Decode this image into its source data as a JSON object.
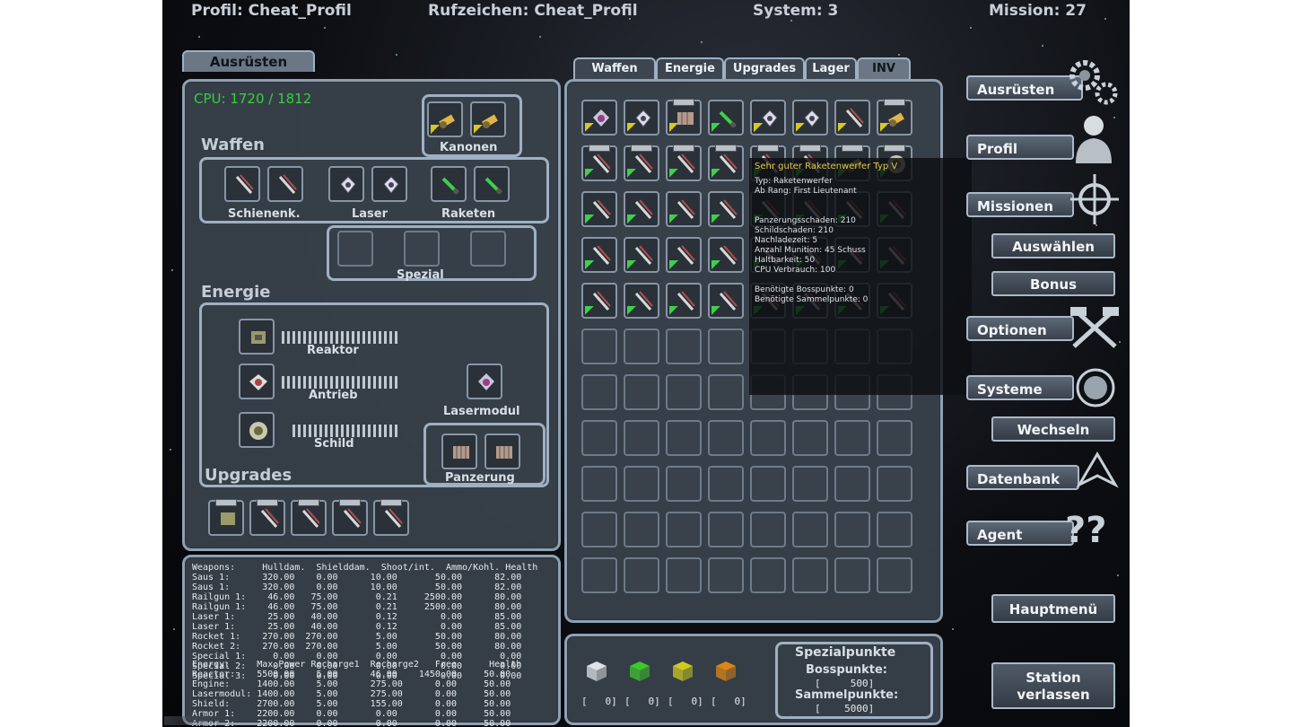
{
  "topbar": {
    "profile": "Profil:  Cheat_Profil",
    "callsign": "Rufzeichen:  Cheat_Profil",
    "system": "System: 3",
    "mission": "Mission: 27"
  },
  "equip_panel": {
    "tab": "Ausrüsten",
    "cpu": "CPU: 1720 / 1812",
    "sections": {
      "weapons": "Waffen",
      "energy": "Energie",
      "upgrades": "Upgrades"
    },
    "labels": {
      "cannons": "Kanonen",
      "railguns": "Schienenk.",
      "laser": "Laser",
      "rockets": "Raketen",
      "special": "Spezial",
      "reactor": "Reaktor",
      "engine": "Antrieb",
      "shield": "Schild",
      "laser_module": "Lasermodul",
      "armor": "Panzerung"
    }
  },
  "inventory": {
    "tabs": [
      "Waffen",
      "Energie",
      "Upgrades",
      "Lager",
      "INV"
    ],
    "active_tab": "INV"
  },
  "tooltip": {
    "title": "Sehr guter Raketenwerfer Typ V",
    "lines": [
      "Typ: Raketenwerfer",
      "Ab Rang: First Lieutenant",
      "",
      "",
      "Panzerungsschaden: 210",
      "Schildschaden: 210",
      "Nachladezeit: 5",
      "Anzahl Munition: 45 Schuss",
      "Haltbarkeit: 50",
      "CPU Verbrauch: 100",
      "",
      "Benötigte Bosspunkte: 0",
      "Benötigte Sammelpunkte: 0"
    ]
  },
  "stats_table": {
    "weapons_header": "Weapons:     Hulldam.  Shielddam.  Shoot/int.  Ammo/Kohl. Health",
    "weapons_rows": [
      "Saus 1:      320.00    0.00      10.00       50.00      82.00",
      "Saus 1:      320.00    0.00      10.00       50.00      82.00",
      "Railgun 1:    46.00   75.00       0.21     2500.00      80.00",
      "Railgun 1:    46.00   75.00       0.21     2500.00      80.00",
      "Laser 1:      25.00   40.00       0.12        0.00      85.00",
      "Laser 1:      25.00   40.00       0.12        0.00      85.00",
      "Rocket 1:    270.00  270.00       5.00       50.00      80.00",
      "Rocket 2:    270.00  270.00       5.00       50.00      80.00",
      "Special 1:     0.00    0.00       0.00        0.00       0.00",
      "Special 2:     0.00    0.00       0.00        0.00       0.00",
      "Special 3:     0.00    0.00       0.00        0.00       0.00"
    ],
    "energy_header": "Energy:     Max.Power Recharge1  Recharge2   Free      Health",
    "energy_rows": [
      "Reactor:    5500.00    5.00      46.00    1450.00     50.00",
      "Engine:     1400.00    5.00      275.00      0.00     50.00",
      "Lasermodul: 1400.00    5.00      275.00      0.00     50.00",
      "Shield:     2700.00    5.00      155.00      0.00     50.00",
      "Armor 1:    2200.00    0.00       0.00       0.00     50.00",
      "Armor 2:    2200.00    0.00       0.00       0.00     50.00"
    ]
  },
  "points": {
    "cubes": [
      {
        "color": "#e8ecef",
        "value": "[   0]"
      },
      {
        "color": "#3fcf2a",
        "value": "[   0]"
      },
      {
        "color": "#d8d21e",
        "value": "[   0]"
      },
      {
        "color": "#e88a12",
        "value": "[   0]"
      }
    ],
    "special_title": "Spezialpunkte",
    "boss_label": "Bosspunkte:",
    "boss_value": "[     500]",
    "collect_label": "Sammelpunkte:",
    "collect_value": "[    5000]"
  },
  "menu": {
    "equip": "Ausrüsten",
    "profile": "Profil",
    "missions": "Missionen",
    "select": "Auswählen",
    "bonus": "Bonus",
    "options": "Optionen",
    "systems": "Systeme",
    "switch": "Wechseln",
    "database": "Datenbank",
    "agent": "Agent",
    "main_menu": "Hauptmenü",
    "leave_station": "Station verlassen"
  },
  "icons": {
    "gear": "gear-icon",
    "pilot": "pilot-portrait-icon",
    "crosshair": "crosshair-icon",
    "hammers": "tools-icon",
    "planet": "planet-icon",
    "ship": "ship-icon",
    "question": "question-icon"
  },
  "colors": {
    "cpu_green": "#36d03a",
    "tooltip_title": "#e7c94a",
    "panel_border": "#8fa0b2"
  }
}
